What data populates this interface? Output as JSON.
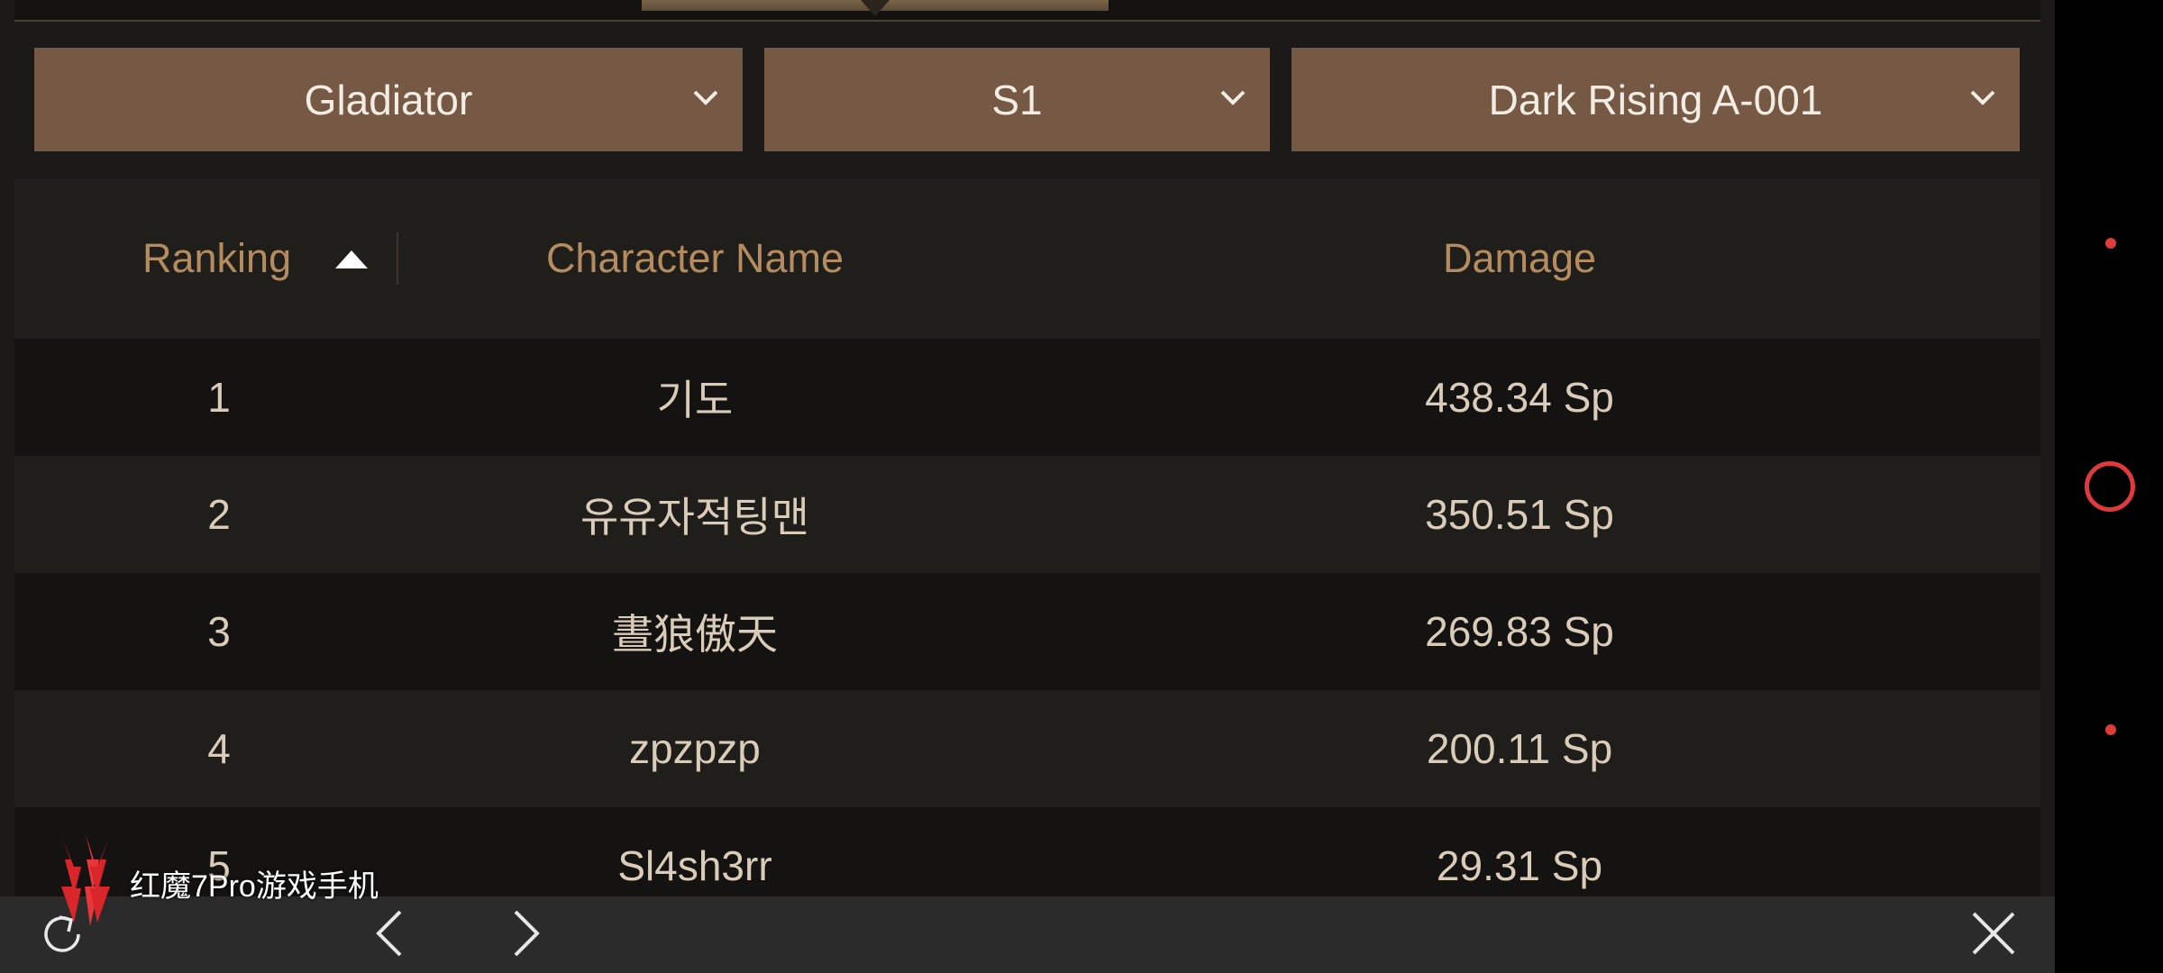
{
  "filters": {
    "class_select": "Gladiator",
    "season_select": "S1",
    "dungeon_select": "Dark Rising A-001"
  },
  "table": {
    "headers": {
      "ranking": "Ranking",
      "character_name": "Character Name",
      "damage": "Damage"
    },
    "sort": "ascending",
    "rows": [
      {
        "rank": "1",
        "name": "기도",
        "damage": "438.34 Sp"
      },
      {
        "rank": "2",
        "name": "유유자적팅맨",
        "damage": "350.51 Sp"
      },
      {
        "rank": "3",
        "name": "晝狼傲天",
        "damage": "269.83 Sp"
      },
      {
        "rank": "4",
        "name": "zpzpzp",
        "damage": "200.11 Sp"
      },
      {
        "rank": "5",
        "name": "Sl4sh3rr",
        "damage": "29.31 Sp"
      }
    ]
  },
  "watermark": {
    "text": "红魔7Pro游戏手机"
  },
  "icons": {
    "dropdown": "chevron-down-icon",
    "sort": "sort-up-arrow-icon",
    "refresh": "refresh-icon",
    "back": "chevron-left-icon",
    "forward": "chevron-right-icon",
    "close": "close-icon"
  },
  "colors": {
    "dropdown_bg": "#755945",
    "header_text": "#b48c5f",
    "row_text": "#d9ccb9",
    "accent_red": "#e03a3a"
  }
}
